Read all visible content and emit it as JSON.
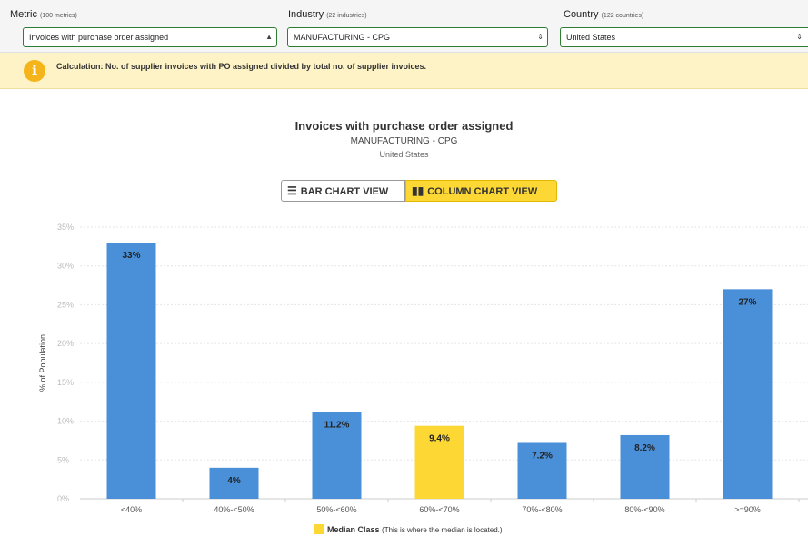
{
  "filters": {
    "metric": {
      "label": "Metric",
      "count": "(100 metrics)",
      "value": "Invoices with purchase order assigned"
    },
    "industry": {
      "label": "Industry",
      "count": "(22 industries)",
      "value": "MANUFACTURING - CPG"
    },
    "country": {
      "label": "Country",
      "count": "(122 countries)",
      "value": "United States"
    }
  },
  "info": {
    "text": "Calculation: No. of supplier invoices with PO assigned divided by total no. of supplier invoices."
  },
  "toggle": {
    "bar_label": "BAR CHART VIEW",
    "column_label": "COLUMN CHART VIEW",
    "active": "column"
  },
  "legend": {
    "label": "Median Class",
    "note": "(This is where the median is located.)"
  },
  "colors": {
    "bar": "#4a90d9",
    "median": "#fdd835",
    "accent": "#2e7d32"
  },
  "chart_data": {
    "type": "bar",
    "title": "Invoices with purchase order assigned",
    "subtitle": "MANUFACTURING - CPG",
    "subtitle2": "United States",
    "xlabel": "",
    "ylabel": "% of Population",
    "ylim": [
      0,
      35
    ],
    "yticks": [
      "0%",
      "5%",
      "10%",
      "15%",
      "20%",
      "25%",
      "30%",
      "35%"
    ],
    "grid": true,
    "categories": [
      "<40%",
      "40%-<50%",
      "50%-<60%",
      "60%-<70%",
      "70%-<80%",
      "80%-<90%",
      ">=90%"
    ],
    "values": [
      33,
      4,
      11.2,
      9.4,
      7.2,
      8.2,
      27
    ],
    "data_labels": [
      "33%",
      "4%",
      "11.2%",
      "9.4%",
      "7.2%",
      "8.2%",
      "27%"
    ],
    "median_category": "60%-<70%"
  }
}
